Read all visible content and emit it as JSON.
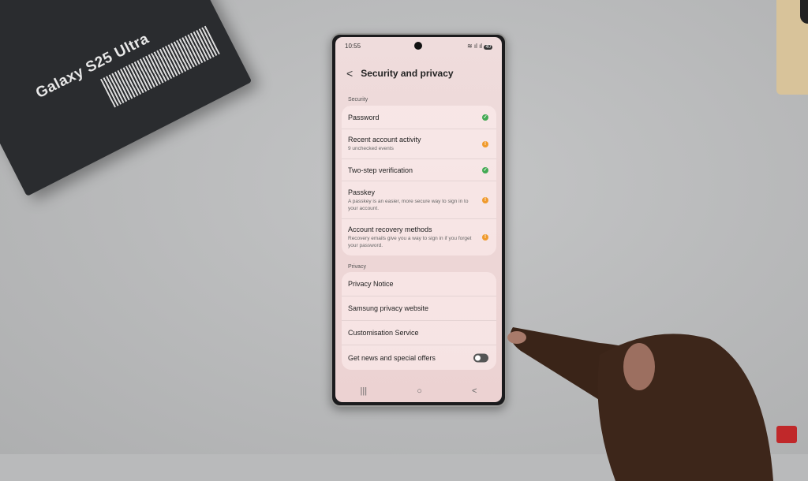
{
  "box": {
    "title": "Galaxy S25 Ultra"
  },
  "status": {
    "time": "10:55",
    "icons": [
      "mail-icon",
      "mute-icon",
      "wifi-icon",
      "signal-icon",
      "battery-icon"
    ],
    "battery": "40"
  },
  "header": {
    "title": "Security and privacy"
  },
  "security": {
    "label": "Security",
    "items": [
      {
        "title": "Password",
        "status": "ok"
      },
      {
        "title": "Recent account activity",
        "subtitle": "9 unchecked events",
        "status": "warning"
      },
      {
        "title": "Two-step verification",
        "status": "ok"
      },
      {
        "title": "Passkey",
        "subtitle": "A passkey is an easier, more secure way to sign in to your account.",
        "status": "warning"
      },
      {
        "title": "Account recovery methods",
        "subtitle": "Recovery emails give you a way to sign in if you forget your password.",
        "status": "warning"
      }
    ]
  },
  "privacy": {
    "label": "Privacy",
    "items": [
      {
        "title": "Privacy Notice"
      },
      {
        "title": "Samsung privacy website"
      },
      {
        "title": "Customisation Service"
      },
      {
        "title": "Get news and special offers",
        "toggle": false
      }
    ]
  },
  "nav": {
    "recents": "|||",
    "home": "○",
    "back": "<"
  },
  "colors": {
    "ok": "#43a953",
    "warning": "#f09a2c",
    "screen": "#efdcdc"
  }
}
